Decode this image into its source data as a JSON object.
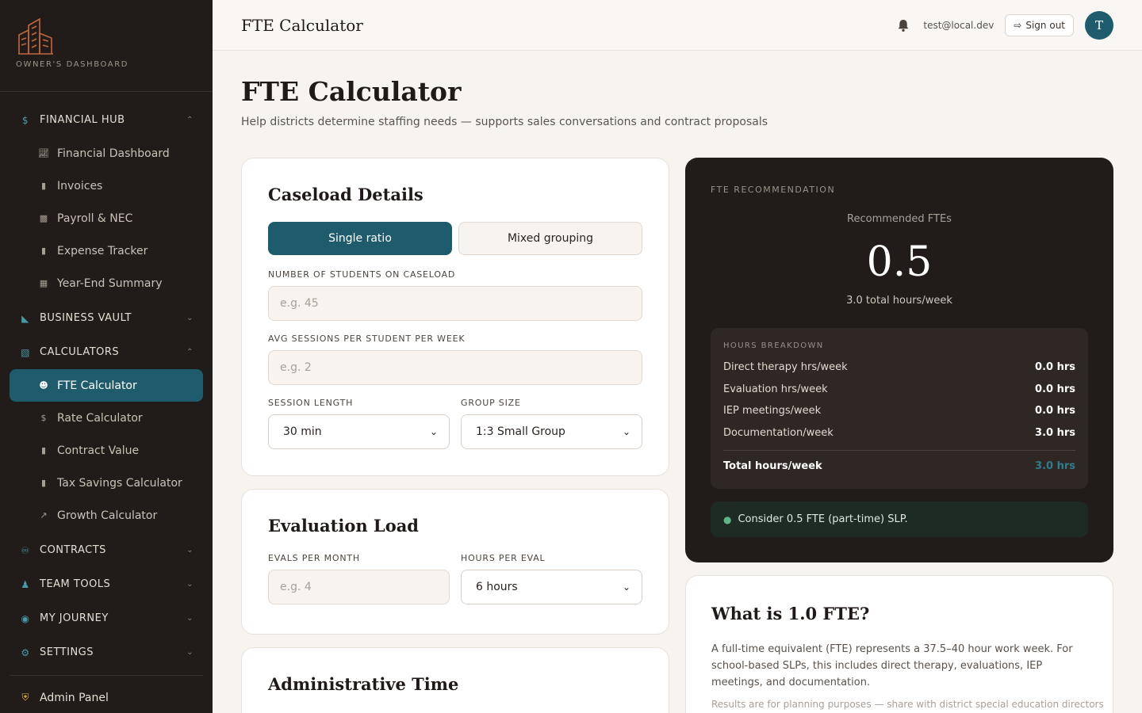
{
  "app": {
    "logo_subtitle": "OWNER'S DASHBOARD",
    "brand_color": "#1e5b6c",
    "accent_color": "#c0683f"
  },
  "sidebar": {
    "groups": [
      {
        "label": "FINANCIAL HUB",
        "icon": "dollar-icon",
        "expanded": true
      },
      {
        "label": "BUSINESS VAULT",
        "icon": "folder-icon",
        "expanded": false
      },
      {
        "label": "CALCULATORS",
        "icon": "calculator-icon",
        "expanded": true
      },
      {
        "label": "CONTRACTS",
        "icon": "handshake-icon",
        "expanded": false
      },
      {
        "label": "TEAM TOOLS",
        "icon": "user-icon",
        "expanded": false
      },
      {
        "label": "MY JOURNEY",
        "icon": "binoculars-icon",
        "expanded": false
      },
      {
        "label": "SETTINGS",
        "icon": "gear-icon",
        "expanded": false
      }
    ],
    "financial_items": [
      {
        "label": "Financial Dashboard",
        "icon": "chart-line-icon"
      },
      {
        "label": "Invoices",
        "icon": "file-icon"
      },
      {
        "label": "Payroll & NEC",
        "icon": "money-icon"
      },
      {
        "label": "Expense Tracker",
        "icon": "receipt-icon"
      },
      {
        "label": "Year-End Summary",
        "icon": "calendar-icon"
      }
    ],
    "calculator_items": [
      {
        "label": "FTE Calculator",
        "icon": "users-icon",
        "active": true
      },
      {
        "label": "Rate Calculator",
        "icon": "dollar-icon"
      },
      {
        "label": "Contract Value",
        "icon": "file-icon"
      },
      {
        "label": "Tax Savings Calculator",
        "icon": "receipt-icon"
      },
      {
        "label": "Growth Calculator",
        "icon": "trend-up-icon"
      }
    ],
    "admin_label": "Admin Panel"
  },
  "topbar": {
    "title": "FTE Calculator",
    "email": "test@local.dev",
    "signout_label": "Sign out",
    "avatar_initial": "T"
  },
  "page": {
    "title": "FTE Calculator",
    "subtitle": "Help districts determine staffing needs — supports sales conversations and contract proposals"
  },
  "caseload": {
    "title": "Caseload Details",
    "mode_single": "Single ratio",
    "mode_mixed": "Mixed grouping",
    "students_label": "NUMBER OF STUDENTS ON CASELOAD",
    "students_placeholder": "e.g. 45",
    "sessions_label": "AVG SESSIONS PER STUDENT PER WEEK",
    "sessions_placeholder": "e.g. 2",
    "length_label": "SESSION LENGTH",
    "length_value": "30 min",
    "group_label": "GROUP SIZE",
    "group_value": "1:3 Small Group"
  },
  "evaluation": {
    "title": "Evaluation Load",
    "evals_label": "EVALS PER MONTH",
    "evals_placeholder": "e.g. 4",
    "hours_label": "HOURS PER EVAL",
    "hours_value": "6 hours"
  },
  "admin_time": {
    "title": "Administrative Time"
  },
  "recommendation": {
    "header": "FTE RECOMMENDATION",
    "rec_label": "Recommended FTEs",
    "fte_value": "0.5",
    "total_hours": "3.0 total hours/week",
    "breakdown_title": "HOURS BREAKDOWN",
    "rows": [
      {
        "label": "Direct therapy hrs/week",
        "value": "0.0 hrs"
      },
      {
        "label": "Evaluation hrs/week",
        "value": "0.0 hrs"
      },
      {
        "label": "IEP meetings/week",
        "value": "0.0 hrs"
      },
      {
        "label": "Documentation/week",
        "value": "3.0 hrs"
      }
    ],
    "total_label": "Total hours/week",
    "total_value": "3.0 hrs",
    "tip": "Consider 0.5 FTE (part-time) SLP."
  },
  "info": {
    "title": "What is 1.0 FTE?",
    "body": "A full-time equivalent (FTE) represents a 37.5–40 hour work week. For school-based SLPs, this includes direct therapy, evaluations, IEP meetings, and documentation.",
    "footnote": "Results are for planning purposes — share with district special education directors"
  }
}
